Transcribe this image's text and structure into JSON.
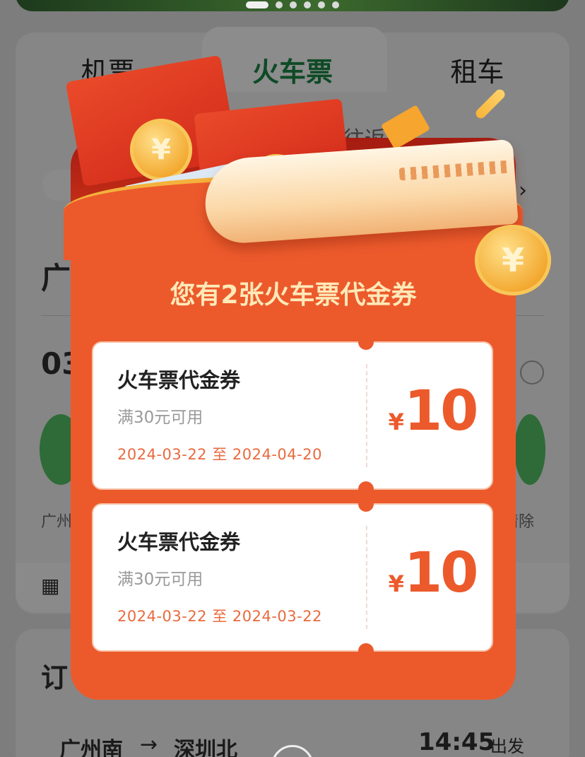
{
  "background": {
    "tabs": [
      {
        "label": "机票",
        "active": false
      },
      {
        "label": "火车票",
        "active": true
      },
      {
        "label": "租车",
        "active": false
      }
    ],
    "partial_texts": {
      "roundtrip": "往返",
      "from_station": "广",
      "date": "03",
      "history_left": "广州",
      "clear": "清除",
      "orders_title": "订"
    },
    "upcoming_trip": {
      "from": "广州南",
      "to": "深圳北",
      "time": "14:45",
      "time_suffix": "出发"
    }
  },
  "popup": {
    "title": "您有2张火车票代金券",
    "colors": {
      "accent": "#ec5a2c",
      "title": "#ffe9b8",
      "date": "#e96a3e"
    },
    "coupons": [
      {
        "name": "火车票代金券",
        "condition": "满30元可用",
        "date_range": "2024-03-22 至 2024-04-20",
        "currency": "¥",
        "amount": "10"
      },
      {
        "name": "火车票代金券",
        "condition": "满30元可用",
        "date_range": "2024-03-22 至 2024-03-22",
        "currency": "¥",
        "amount": "10"
      }
    ]
  }
}
